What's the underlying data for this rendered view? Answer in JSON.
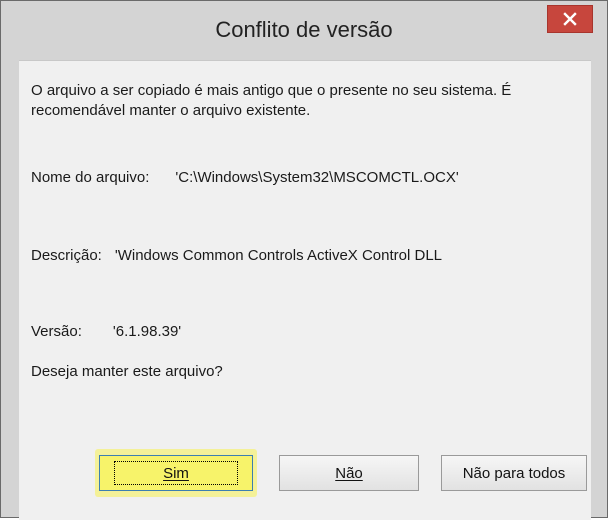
{
  "window": {
    "title": "Conflito de versão"
  },
  "message": "O arquivo a ser copiado é mais antigo que o presente no seu sistema.  É recomendável manter o arquivo existente.",
  "file": {
    "label": "Nome do arquivo:",
    "value": "'C:\\Windows\\System32\\MSCOMCTL.OCX'"
  },
  "description": {
    "label": "Descrição:",
    "value": "'Windows Common Controls ActiveX Control DLL"
  },
  "version": {
    "label": "Versão:",
    "value": "'6.1.98.39'"
  },
  "question": "Deseja manter este arquivo?",
  "buttons": {
    "yes": "Sim",
    "no": "Não",
    "no_all": "Não para todos"
  },
  "colors": {
    "close_button": "#c7463d",
    "highlight": "#f7f36a"
  },
  "icons": {
    "close": "close-icon"
  }
}
